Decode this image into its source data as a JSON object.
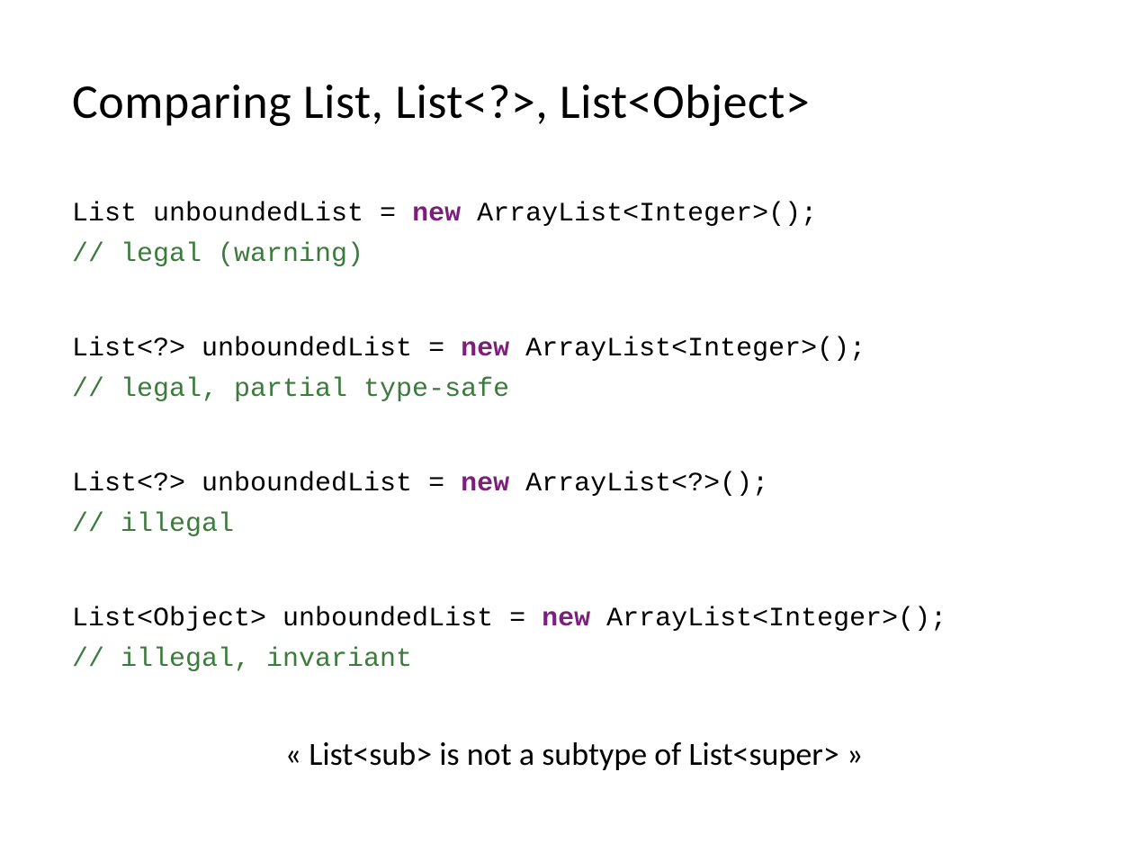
{
  "title": "Comparing List, List<?>, List<Object>",
  "code1": {
    "prefix": "List unboundedList = ",
    "keyword": "new",
    "suffix": " ArrayList<Integer>();",
    "comment": "// legal (warning)"
  },
  "code2": {
    "prefix": "List<?> unboundedList = ",
    "keyword": "new",
    "suffix": " ArrayList<Integer>();",
    "comment": "// legal, partial type-safe"
  },
  "code3": {
    "prefix": "List<?> unboundedList = ",
    "keyword": "new",
    "suffix": " ArrayList<?>();",
    "comment": "// illegal"
  },
  "code4": {
    "prefix": "List<Object> unboundedList = ",
    "keyword": "new",
    "suffix": " ArrayList<Integer>();",
    "comment": "// illegal, invariant"
  },
  "quote": "« List<sub> is not a subtype of List<super> »"
}
